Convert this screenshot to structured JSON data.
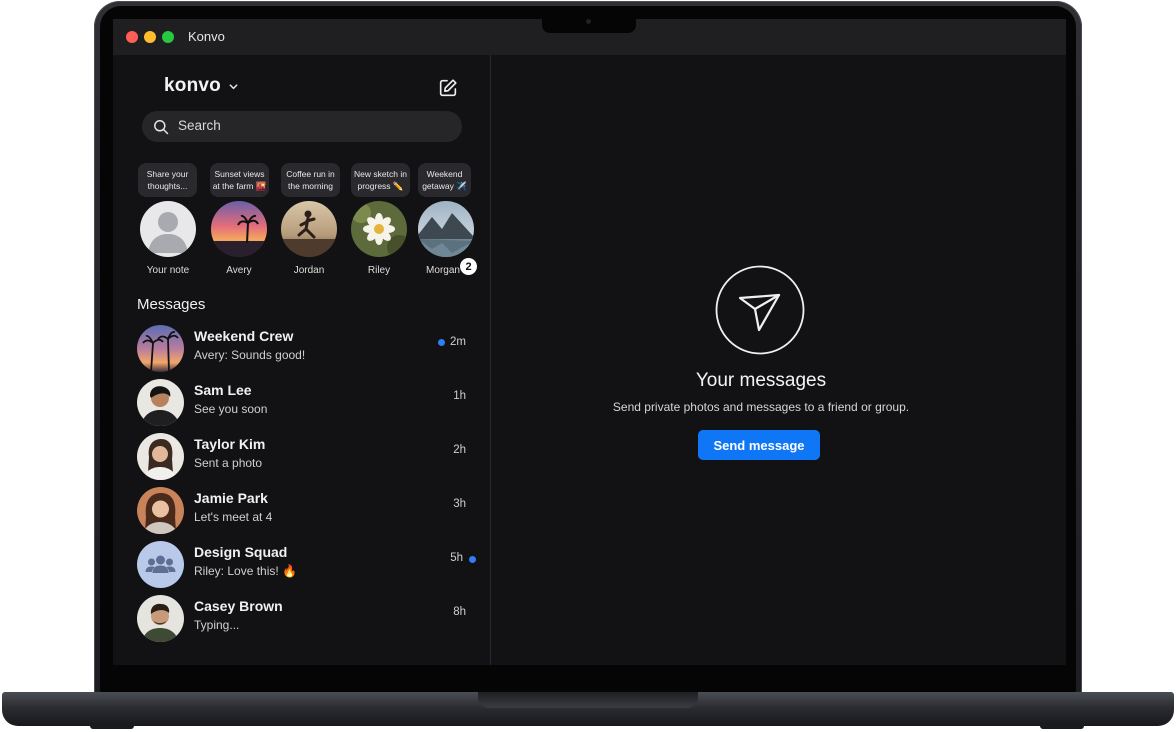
{
  "window": {
    "title": "Konvo"
  },
  "sidebar": {
    "account_name": "konvo",
    "search_placeholder": "Search",
    "stories": [
      {
        "note": "Share your thoughts...",
        "name": "Your note"
      },
      {
        "note": "Sunset views at the farm 🌇",
        "name": "Avery"
      },
      {
        "note": "Coffee run in the morning",
        "name": "Jordan"
      },
      {
        "note": "New sketch in progress ✏️",
        "name": "Riley"
      },
      {
        "note": "Weekend getaway ✈️",
        "name": "Morgan",
        "badge": "2"
      }
    ],
    "messages_title": "Messages",
    "messages": [
      {
        "name": "Weekend Crew",
        "preview": "Avery: Sounds good!",
        "time": "2m",
        "unread": true
      },
      {
        "name": "Sam Lee",
        "preview": "See you soon",
        "time": "1h",
        "unread": false
      },
      {
        "name": "Taylor Kim",
        "preview": "Sent a photo",
        "time": "2h",
        "unread": false
      },
      {
        "name": "Jamie Park",
        "preview": "Let's meet at 4",
        "time": "3h",
        "unread": false
      },
      {
        "name": "Design Squad",
        "preview": "Riley: Love this! 🔥",
        "time": "5h",
        "unread": true
      },
      {
        "name": "Casey Brown",
        "preview": "Typing...",
        "time": "8h",
        "unread": false
      }
    ]
  },
  "main": {
    "title": "Your messages",
    "subtitle": "Send private photos and messages to a friend or group.",
    "button_label": "Send message"
  },
  "colors": {
    "accent": "#0f76f6",
    "unread_dot": "#2f7ef6",
    "background": "#121214",
    "search_bg": "#262629"
  },
  "icons": {
    "account_menu": "chevron-down-icon",
    "compose": "compose-icon",
    "search": "search-icon",
    "empty_state": "send-icon",
    "group": "group-icon"
  }
}
